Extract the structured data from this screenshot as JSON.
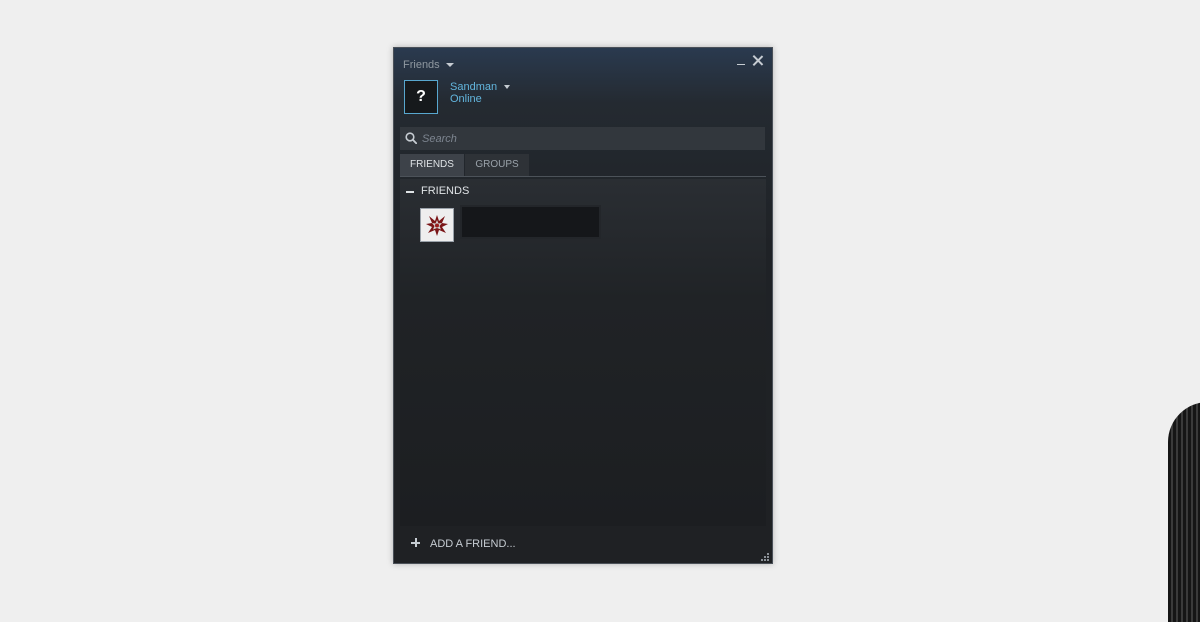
{
  "window": {
    "title": "Friends",
    "title_menu_icon": "caret-down-icon",
    "minimize_icon": "minimize-icon",
    "close_icon": "close-icon"
  },
  "user": {
    "avatar_placeholder": "?",
    "name": "Sandman",
    "status": "Online",
    "status_color": "#62b5dd",
    "menu_icon": "caret-down-icon"
  },
  "search": {
    "placeholder": "Search",
    "value": "",
    "icon": "search-icon"
  },
  "tabs": [
    {
      "label": "FRIENDS",
      "active": true
    },
    {
      "label": "GROUPS",
      "active": false
    }
  ],
  "friends_section": {
    "toggle": "collapse-icon",
    "label": "FRIENDS",
    "items": [
      {
        "avatar": "friend-emblem-avatar"
      }
    ]
  },
  "footer": {
    "add_icon": "plus-icon",
    "add_label": "ADD A FRIEND..."
  },
  "colors": {
    "accent": "#62b5dd",
    "window_bg": "#1f2124",
    "desktop_bg": "#efefef"
  }
}
